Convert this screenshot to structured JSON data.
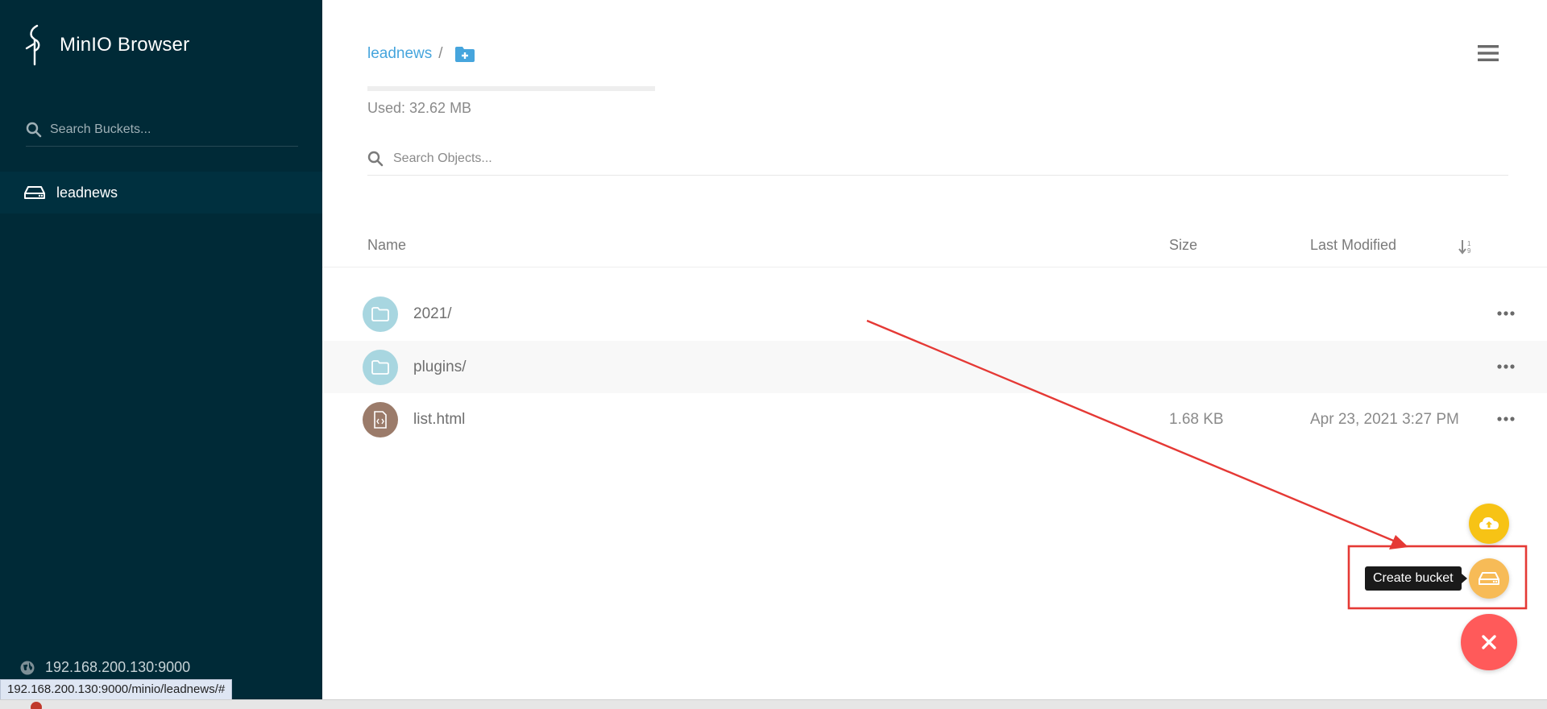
{
  "app": {
    "title": "MinIO Browser"
  },
  "sidebar": {
    "search_placeholder": "Search Buckets...",
    "buckets": [
      {
        "label": "leadnews"
      }
    ],
    "host": "192.168.200.130:9000"
  },
  "breadcrumb": {
    "bucket": "leadnews",
    "separator": "/"
  },
  "usage": {
    "text": "Used: 32.62 MB"
  },
  "objects": {
    "search_placeholder": "Search Objects...",
    "columns": {
      "name": "Name",
      "size": "Size",
      "modified": "Last Modified"
    },
    "rows": [
      {
        "name": "2021/",
        "size": "",
        "modified": "",
        "type": "folder",
        "icon": "folder-icon"
      },
      {
        "name": "plugins/",
        "size": "",
        "modified": "",
        "type": "folder",
        "icon": "folder-icon"
      },
      {
        "name": "list.html",
        "size": "1.68 KB",
        "modified": "Apr 23, 2021 3:27 PM",
        "type": "file",
        "icon": "code-file-icon"
      }
    ]
  },
  "fab": {
    "tooltip": "Create bucket"
  },
  "status_url": "192.168.200.130:9000/minio/leadnews/#",
  "colors": {
    "sidebar_bg": "#002a37",
    "accent_link": "#46a5dd",
    "folder_icon_bg": "#a8d6e0",
    "file_icon_bg": "#9b7b6a",
    "fab_upload": "#f7c315",
    "fab_bucket": "#f7bb57",
    "fab_close": "#ff5a5a",
    "annotation_red": "#e53935"
  }
}
